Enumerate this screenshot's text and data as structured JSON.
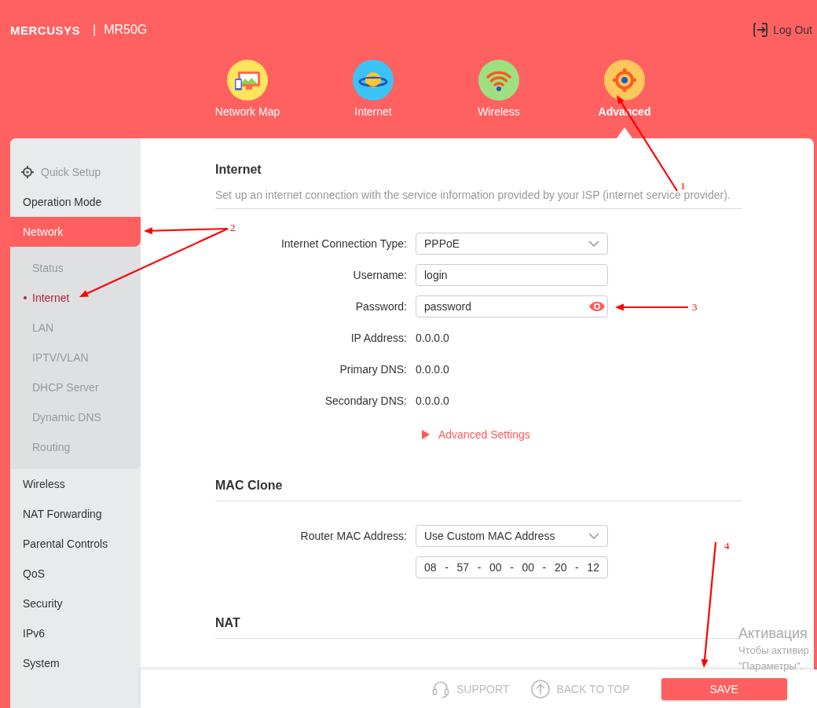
{
  "header": {
    "brand": "MERCUSYS",
    "separator": "|",
    "model": "MR50G",
    "logout": "Log Out"
  },
  "nav": [
    {
      "label": "Network Map",
      "selected": false
    },
    {
      "label": "Internet",
      "selected": false
    },
    {
      "label": "Wireless",
      "selected": false
    },
    {
      "label": "Advanced",
      "selected": true
    }
  ],
  "sidebar": {
    "items": [
      {
        "label": "Quick Setup",
        "kind": "quick",
        "selected": false
      },
      {
        "label": "Operation Mode",
        "kind": "item",
        "selected": false
      },
      {
        "label": "Network",
        "kind": "item",
        "selected": true,
        "expanded": true,
        "children": [
          {
            "label": "Status",
            "selected": false
          },
          {
            "label": "Internet",
            "selected": true
          },
          {
            "label": "LAN",
            "selected": false
          },
          {
            "label": "IPTV/VLAN",
            "selected": false
          },
          {
            "label": "DHCP Server",
            "selected": false
          },
          {
            "label": "Dynamic DNS",
            "selected": false
          },
          {
            "label": "Routing",
            "selected": false
          }
        ]
      },
      {
        "label": "Wireless",
        "kind": "item",
        "selected": false
      },
      {
        "label": "NAT Forwarding",
        "kind": "item",
        "selected": false
      },
      {
        "label": "Parental Controls",
        "kind": "item",
        "selected": false
      },
      {
        "label": "QoS",
        "kind": "item",
        "selected": false
      },
      {
        "label": "Security",
        "kind": "item",
        "selected": false
      },
      {
        "label": "IPv6",
        "kind": "item",
        "selected": false
      },
      {
        "label": "System",
        "kind": "item",
        "selected": false
      }
    ]
  },
  "sections": [
    {
      "title": "Internet",
      "description": "Set up an internet connection with the service information provided by your ISP (internet service provider).",
      "fields": [
        {
          "label": "Internet Connection Type:",
          "kind": "select",
          "value": "PPPoE"
        },
        {
          "label": "Username:",
          "kind": "text",
          "value": "login"
        },
        {
          "label": "Password:",
          "kind": "password",
          "value": "password"
        },
        {
          "label": "IP Address:",
          "kind": "static",
          "value": "0.0.0.0"
        },
        {
          "label": "Primary DNS:",
          "kind": "static",
          "value": "0.0.0.0"
        },
        {
          "label": "Secondary DNS:",
          "kind": "static",
          "value": "0.0.0.0"
        }
      ],
      "link": {
        "label": "Advanced Settings",
        "expanded": false
      }
    },
    {
      "title": "MAC Clone",
      "fields": [
        {
          "label": "Router MAC Address:",
          "kind": "select",
          "value": "Use Custom MAC Address"
        },
        {
          "kind": "mac",
          "separator": "-",
          "parts": [
            "08",
            "57",
            "00",
            "00",
            "20",
            "12"
          ]
        }
      ]
    },
    {
      "title": "NAT"
    }
  ],
  "footer": {
    "support": "SUPPORT",
    "back_to_top": "BACK TO TOP",
    "save": "SAVE"
  },
  "os_overlay": [
    "Активация",
    "Чтобы активир",
    "\"Параметры\"."
  ],
  "annotations": [
    {
      "label": "1"
    },
    {
      "label": "2"
    },
    {
      "label": "3"
    },
    {
      "label": "4"
    }
  ]
}
